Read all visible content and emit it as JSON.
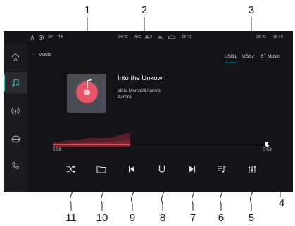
{
  "callouts": {
    "n1": "1",
    "n2": "2",
    "n3": "3",
    "n4": "4",
    "n5": "5",
    "n6": "6",
    "n7": "7",
    "n8": "8",
    "n9": "9",
    "n10": "10",
    "n11": "11"
  },
  "status_bar": {
    "left_items": [
      "SF",
      "TA"
    ],
    "climate_left": "24 °C",
    "ac": "A/C",
    "fan_level": "3",
    "climate_right": "22 °C",
    "outside_temp": "26 °C",
    "clock": "18:49"
  },
  "header": {
    "back_label": "Music",
    "tabs": [
      "USB1",
      "USB2",
      "BT Music"
    ],
    "active_tab": "USB1"
  },
  "track": {
    "title": "Into the Unkown",
    "artist": "Idina Menzel&Aurora",
    "album": "Aurora"
  },
  "progress": {
    "elapsed": "5:58",
    "total": "5:58",
    "played_fraction": 0.36
  },
  "sidebar_icons": [
    "home-icon",
    "music-icon",
    "radio-icon",
    "car-icon",
    "phone-icon"
  ],
  "controls": [
    "shuffle-icon",
    "folder-icon",
    "previous-icon",
    "play-pause-icon",
    "next-icon",
    "playlist-icon",
    "equalizer-icon"
  ],
  "colors": {
    "accent": "#3ac3c8",
    "progress": "#e8505e",
    "background": "#141418"
  }
}
